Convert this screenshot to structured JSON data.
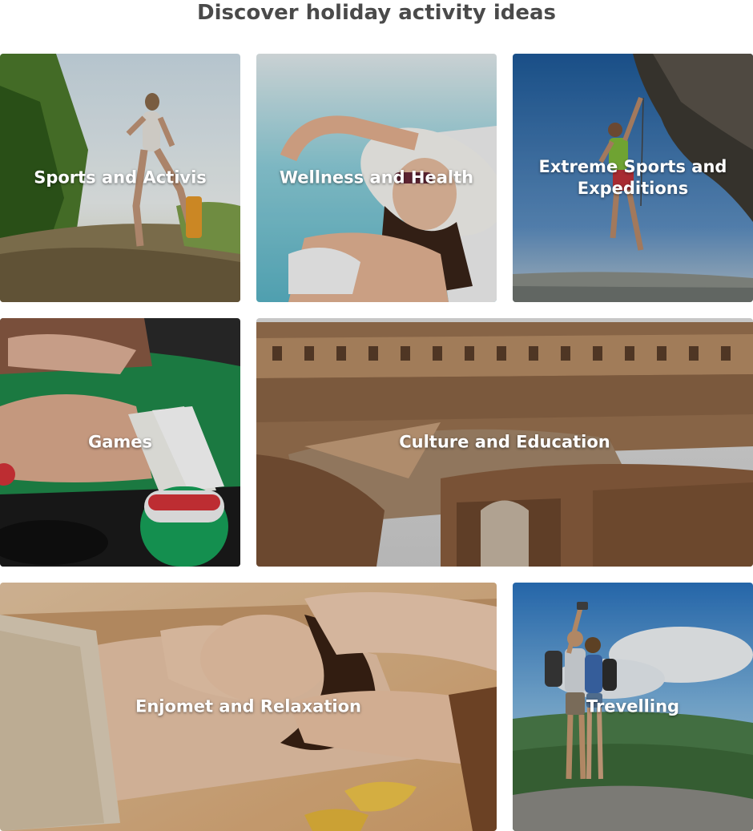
{
  "page": {
    "heading": "Discover holiday activity ideas"
  },
  "tiles": [
    {
      "label": "Sports and Activis"
    },
    {
      "label": "Wellness and Health"
    },
    {
      "label": "Extreme Sports and Expeditions"
    },
    {
      "label": "Games"
    },
    {
      "label": "Culture and Education"
    },
    {
      "label": "Enjomet and Relaxation"
    },
    {
      "label": "Trevelling"
    }
  ],
  "colors": {
    "heading": "#4a4a4a",
    "label": "#ffffff"
  }
}
